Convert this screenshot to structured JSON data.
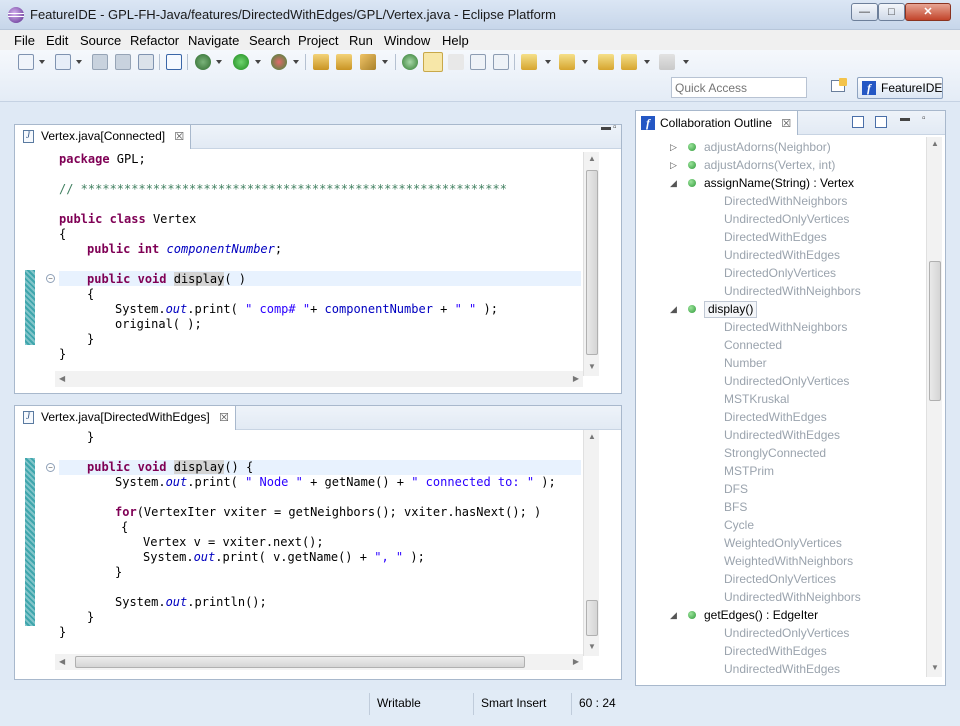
{
  "window": {
    "title": "FeatureIDE - GPL-FH-Java/features/DirectedWithEdges/GPL/Vertex.java - Eclipse Platform",
    "min_glyph": "—",
    "max_glyph": "□",
    "close_glyph": "✕"
  },
  "menu": [
    "File",
    "Edit",
    "Source",
    "Refactor",
    "Navigate",
    "Search",
    "Project",
    "Run",
    "Window",
    "Help"
  ],
  "toolbar": {
    "quick_access_placeholder": "Quick Access",
    "perspective_label": "FeatureIDE",
    "perspective_icon": "f"
  },
  "editor1": {
    "tab_label": "Vertex.java[Connected]",
    "close_glyph": "☒"
  },
  "editor2": {
    "tab_label": "Vertex.java[DirectedWithEdges]",
    "close_glyph": "☒"
  },
  "code1": {
    "l1_kw": "package",
    "l1_rest": " GPL;",
    "l2_comment": "// ***********************************************************",
    "l3_kw1": "public",
    "l3_kw2": "class",
    "l3_rest": " Vertex",
    "l4": "{",
    "l5_kw1": "public",
    "l5_kw2": "int",
    "l5_field": "componentNumber",
    "l5_end": ";",
    "l6_kw1": "public",
    "l6_kw2": "void",
    "l6_name": "display",
    "l6_rest": "( )",
    "l7": "{",
    "l8_a": "System.",
    "l8_out": "out",
    "l8_b": ".print( ",
    "l8_str1": "\" comp# \"",
    "l8_c": "+ ",
    "l8_field": "componentNumber",
    "l8_d": " + ",
    "l8_str2": "\" \"",
    "l8_e": " );",
    "l9": "original( );",
    "l10": "}",
    "l11": "}"
  },
  "code2": {
    "l1": "}",
    "l2_kw1": "public",
    "l2_kw2": "void",
    "l2_name": "display",
    "l2_rest": "() {",
    "l3_a": "System.",
    "l3_out": "out",
    "l3_b": ".print( ",
    "l3_str1": "\" Node \"",
    "l3_c": " + getName() + ",
    "l3_str2": "\" connected to: \"",
    "l3_e": " );",
    "l4_kw": "for",
    "l4_rest": "(VertexIter vxiter = getNeighbors(); vxiter.hasNext(); )",
    "l5": "{",
    "l6": "Vertex v = vxiter.next();",
    "l7_a": "System.",
    "l7_out": "out",
    "l7_b": ".print( v.getName() + ",
    "l7_str": "\", \"",
    "l7_e": " );",
    "l8": "}",
    "l9_a": "System.",
    "l9_out": "out",
    "l9_b": ".println();",
    "l10": "}",
    "l11": "}"
  },
  "outline": {
    "tab_label": "Collaboration Outline",
    "close_glyph": "☒",
    "rows": [
      {
        "text": "adjustAdorns(Neighbor)",
        "dim": true
      },
      {
        "text": "adjustAdorns(Vertex, int)",
        "dim": true
      },
      {
        "text": "assignName(String) : Vertex",
        "dim": false
      },
      {
        "text": "DirectedWithNeighbors"
      },
      {
        "text": "UndirectedOnlyVertices"
      },
      {
        "text": "DirectedWithEdges"
      },
      {
        "text": "UndirectedWithEdges"
      },
      {
        "text": "DirectedOnlyVertices"
      },
      {
        "text": "UndirectedWithNeighbors"
      },
      {
        "text": "display()",
        "dim": false
      },
      {
        "text": "DirectedWithNeighbors"
      },
      {
        "text": "Connected"
      },
      {
        "text": "Number"
      },
      {
        "text": "UndirectedOnlyVertices"
      },
      {
        "text": "MSTKruskal"
      },
      {
        "text": "DirectedWithEdges"
      },
      {
        "text": "UndirectedWithEdges"
      },
      {
        "text": "StronglyConnected"
      },
      {
        "text": "MSTPrim"
      },
      {
        "text": "DFS"
      },
      {
        "text": "BFS"
      },
      {
        "text": "Cycle"
      },
      {
        "text": "WeightedOnlyVertices"
      },
      {
        "text": "WeightedWithNeighbors"
      },
      {
        "text": "DirectedOnlyVertices"
      },
      {
        "text": "UndirectedWithNeighbors"
      },
      {
        "text": "getEdges() : EdgeIter",
        "dim": false
      },
      {
        "text": "UndirectedOnlyVertices"
      },
      {
        "text": "DirectedWithEdges"
      },
      {
        "text": "UndirectedWithEdges"
      }
    ]
  },
  "status": {
    "writable": "Writable",
    "insert_mode": "Smart Insert",
    "position": "60 : 24"
  },
  "colors": {
    "keyword": "#7f0055",
    "comment": "#3f7f5f",
    "string": "#2a00ff",
    "field": "#0000c0",
    "current_line": "#e8f2fe",
    "change_ruler": "#3fa6ad"
  }
}
